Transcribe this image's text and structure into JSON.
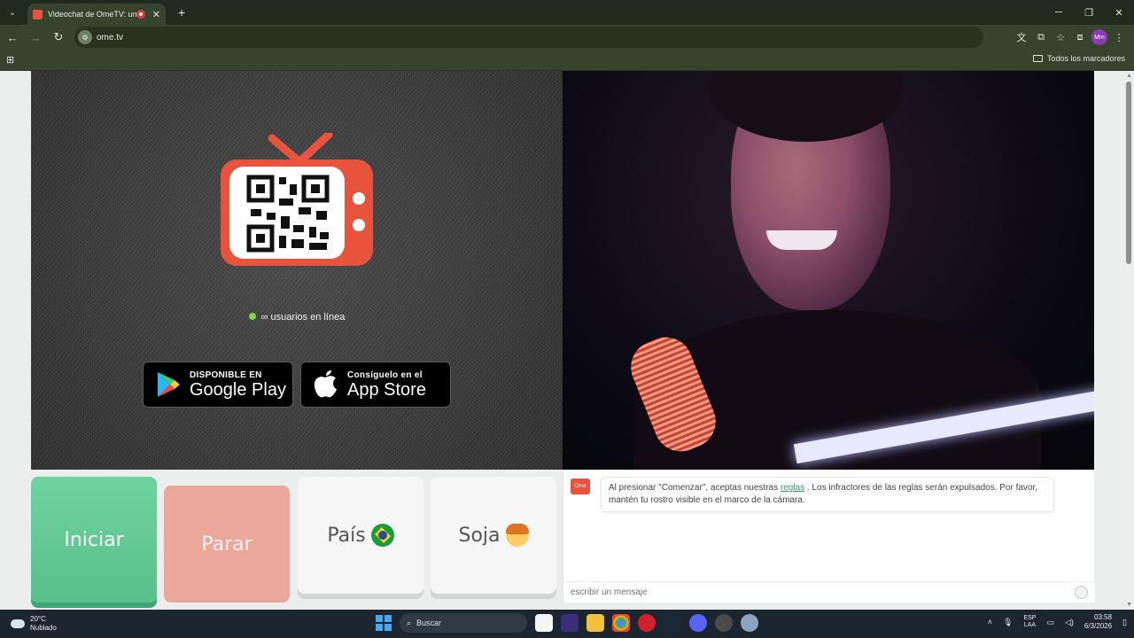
{
  "browser": {
    "tab_title": "Videochat de OmeTV: uno",
    "url": "ome.tv",
    "site_icon": "ome-icon",
    "bookmarks_label": "Todos los marcadores",
    "profile_initials": "Mm"
  },
  "left_panel": {
    "online_text": "∞ usuarios en línea",
    "google_play_small": "DISPONIBLE EN",
    "google_play_big": "Google Play",
    "app_store_small": "Consíguelo en el",
    "app_store_big": "App Store"
  },
  "controls": {
    "start_label": "Iniciar",
    "stop_label": "Parar",
    "country_label": "País",
    "gender_label": "Soja"
  },
  "chat": {
    "logo_text": "Ome TV",
    "message_before": "Al presionar \"Comenzar\", aceptas nuestras",
    "message_link": "reglas",
    "message_after": ". Los infractores de las reglas serán expulsados. Por favor, mantén tu rostro visible en el marco de la cámara.",
    "input_placeholder": "escribir un mensaje"
  },
  "taskbar": {
    "temperature": "20°C",
    "weather": "Nublado",
    "search_label": "Buscar",
    "lang_top": "ESP",
    "lang_bottom": "LAA",
    "time": "03:58",
    "date": "6/3/2026"
  },
  "colors": {
    "start_button": "#58c08a",
    "stop_button": "#eaa79a",
    "brand": "#e8533e",
    "online_dot": "#7bde3a"
  }
}
